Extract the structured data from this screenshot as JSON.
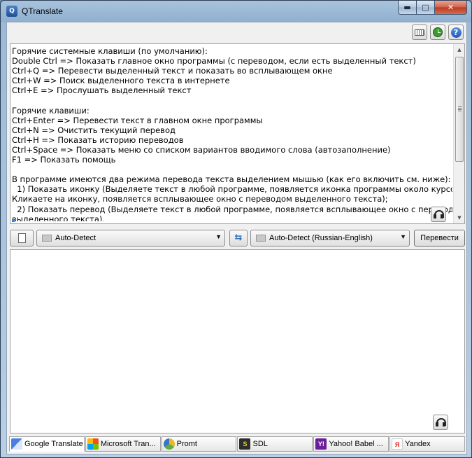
{
  "window": {
    "title": "QTranslate"
  },
  "caption_buttons": {
    "minimize": "▬",
    "maximize": "□",
    "close": "✕"
  },
  "icons": {
    "app": "qtranslate-app-icon",
    "keyboard": "virtual-keyboard-icon",
    "history": "clock-icon",
    "help": "help-icon",
    "listen": "headphones-icon",
    "new": "new-document-icon",
    "swap": "swap-arrows-icon"
  },
  "help_glyph": "?",
  "source": {
    "text": "Горячие системные клавиши (по умолчанию):\nDouble Ctrl => Показать главное окно программы (с переводом, если есть выделенный текст)\nCtrl+Q => Перевести выделенный текст и показать во всплывающем окне\nCtrl+W => Поиск выделенного текста в интернете\nCtrl+E => Прослушать выделенный текст\n\nГорячие клавиши:\nCtrl+Enter => Перевести текст в главном окне программы\nCtrl+N => Очистить текущий перевод\nCtrl+H => Показать историю переводов\nCtrl+Space => Показать меню со списком вариантов вводимого слова (автозаполнение)\nF1 => Показать помощь\n\nВ программе имеются два режима перевода текста выделением мышью (как его включить см. ниже):\n  1) Показать иконку (Выделяете текст в любой программе, появляется иконка программы около курсора.\nКликаете на иконку, появляется всплывающее окно с переводом выделенного текста);\n  2) Показать перевод (Выделяете текст в любой программе, появляется всплывающее окно с переводом\nвыделенного текста)."
  },
  "languages": {
    "source": "Auto-Detect",
    "target": "Auto-Detect (Russian-English)",
    "swap_glyph": "⇆",
    "dropdown_glyph": "▼"
  },
  "translate_button": "Перевести",
  "result": {
    "text": ""
  },
  "tabs": [
    {
      "label": "Google Translate",
      "icon": "google-translate-icon",
      "glyph": "",
      "active": true
    },
    {
      "label": "Microsoft Tran...",
      "icon": "microsoft-icon",
      "glyph": "",
      "active": false
    },
    {
      "label": "Promt",
      "icon": "promt-icon",
      "glyph": "",
      "active": false
    },
    {
      "label": "SDL",
      "icon": "sdl-icon",
      "glyph": "S",
      "active": false
    },
    {
      "label": "Yahoo! Babel ...",
      "icon": "yahoo-icon",
      "glyph": "Y!",
      "active": false
    },
    {
      "label": "Yandex",
      "icon": "yandex-icon",
      "glyph": "Я",
      "active": false
    }
  ],
  "colors": {
    "accent": "#3b7fd6",
    "close_button": "#c84a30",
    "window_frame": "#9cbad6"
  }
}
